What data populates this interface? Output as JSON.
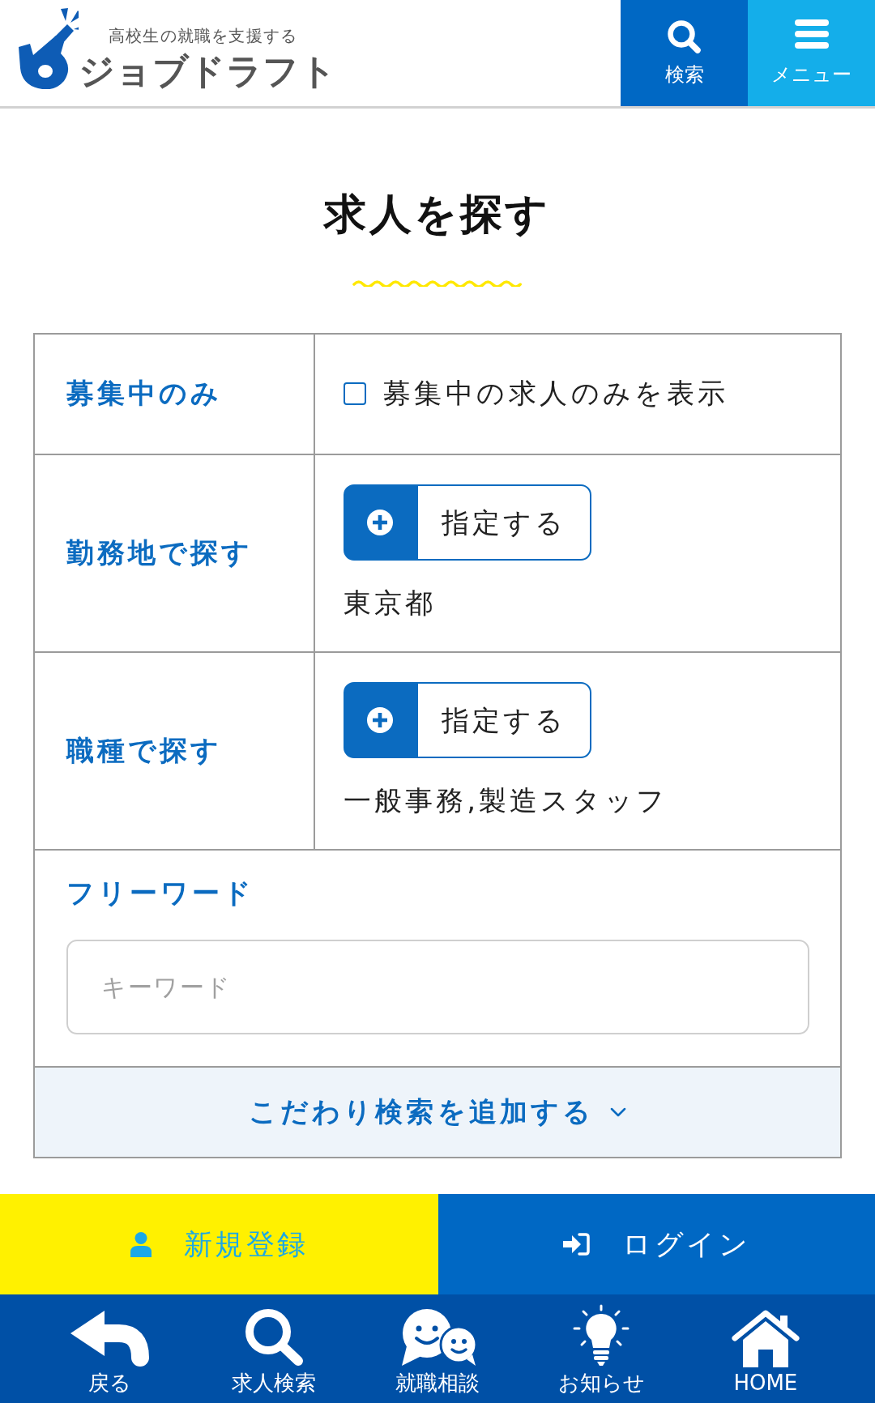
{
  "header": {
    "tagline": "高校生の就職を支援する",
    "logo_text": "ジョブドラフト",
    "buttons": [
      {
        "kind": "search",
        "label": "検索"
      },
      {
        "kind": "menu",
        "label": "メニュー"
      }
    ]
  },
  "page_title": "求人を探す",
  "form": {
    "rows": [
      {
        "kind": "checkbox",
        "label": "募集中のみ",
        "option": "募集中の求人のみを表示",
        "checked": false
      },
      {
        "kind": "picker",
        "label": "勤務地で探す",
        "button": "指定する",
        "value": "東京都"
      },
      {
        "kind": "picker",
        "label": "職種で探す",
        "button": "指定する",
        "value": "一般事務,製造スタッフ"
      },
      {
        "kind": "text",
        "label": "フリーワード",
        "placeholder": "キーワード"
      }
    ],
    "more_toggle": {
      "label": "こだわり検索を追加する",
      "expanded": false
    }
  },
  "account_bar": [
    {
      "kind": "register",
      "label": "新規登録"
    },
    {
      "kind": "login",
      "label": "ログイン"
    }
  ],
  "bottom_nav": [
    {
      "kind": "back",
      "label": "戻る"
    },
    {
      "kind": "search",
      "label": "求人検索"
    },
    {
      "kind": "consult",
      "label": "就職相談"
    },
    {
      "kind": "news",
      "label": "お知らせ"
    },
    {
      "kind": "home",
      "label": "HOME"
    }
  ]
}
